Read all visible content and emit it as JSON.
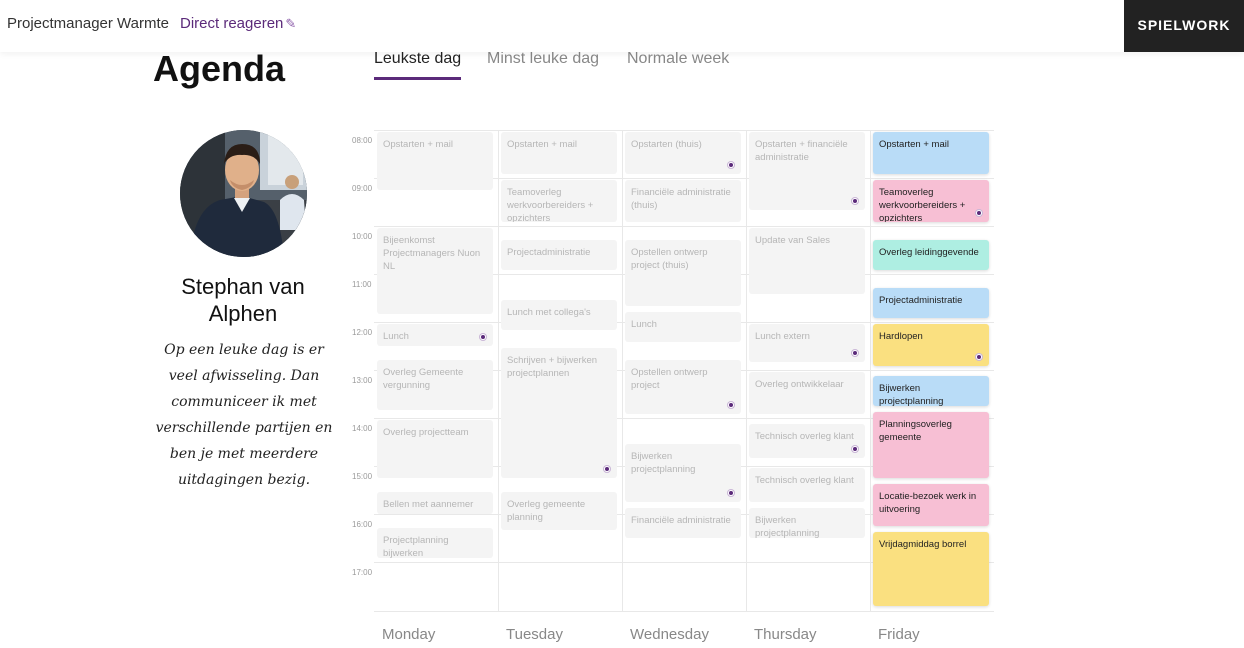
{
  "header": {
    "job_title": "Projectmanager Warmte",
    "apply_label": "Direct reageren",
    "brand": "SPIELWORK",
    "pencil_icon": "pencil-icon"
  },
  "page": {
    "title": "Agenda",
    "tabs": [
      {
        "label": "Leukste dag",
        "active": true
      },
      {
        "label": "Minst leuke dag",
        "active": false
      },
      {
        "label": "Normale week",
        "active": false
      }
    ]
  },
  "profile": {
    "name": "Stephan van Alphen",
    "quote": "Op een leuke dag is er veel afwisseling. Dan communiceer ik met verschillende partijen en ben je met meerdere uitdagingen bezig."
  },
  "calendar": {
    "hours": [
      "08:00",
      "09:00",
      "10:00",
      "11:00",
      "12:00",
      "13:00",
      "14:00",
      "15:00",
      "16:00",
      "17:00"
    ],
    "days": [
      {
        "label": "Monday",
        "events": [
          {
            "title": "Opstarten + mail",
            "start": "08:00",
            "end": "09:15",
            "dot": false
          },
          {
            "title": "Bijeenkomst Projectmanagers Nuon NL",
            "start": "10:00",
            "end": "11:50",
            "dot": false
          },
          {
            "title": "Lunch",
            "start": "12:00",
            "end": "12:30",
            "dot": true
          },
          {
            "title": "Overleg Gemeente vergunning",
            "start": "12:45",
            "end": "13:50",
            "dot": false
          },
          {
            "title": "Overleg projectteam",
            "start": "14:00",
            "end": "15:15",
            "dot": false
          },
          {
            "title": "Bellen met aannemer",
            "start": "15:30",
            "end": "16:00",
            "dot": false
          },
          {
            "title": "Projectplanning bijwerken",
            "start": "16:15",
            "end": "16:55",
            "dot": false
          }
        ]
      },
      {
        "label": "Tuesday",
        "events": [
          {
            "title": "Opstarten + mail",
            "start": "08:00",
            "end": "08:55",
            "dot": false
          },
          {
            "title": "Teamoverleg werkvoorbereiders + opzichters",
            "start": "09:00",
            "end": "09:55",
            "dot": false
          },
          {
            "title": "Projectadministratie",
            "start": "10:15",
            "end": "10:55",
            "dot": false
          },
          {
            "title": "Lunch met collega's",
            "start": "11:30",
            "end": "12:10",
            "dot": false
          },
          {
            "title": "Schrijven + bijwerken projectplannen",
            "start": "12:30",
            "end": "15:15",
            "dot": true
          },
          {
            "title": "Overleg gemeente planning",
            "start": "15:30",
            "end": "16:20",
            "dot": false
          }
        ]
      },
      {
        "label": "Wednesday",
        "events": [
          {
            "title": "Opstarten (thuis)",
            "start": "08:00",
            "end": "08:55",
            "dot": true
          },
          {
            "title": "Financiële administratie (thuis)",
            "start": "09:00",
            "end": "09:55",
            "dot": false
          },
          {
            "title": "Opstellen ontwerp project (thuis)",
            "start": "10:15",
            "end": "11:40",
            "dot": false
          },
          {
            "title": "Lunch",
            "start": "11:45",
            "end": "12:25",
            "dot": false
          },
          {
            "title": "Opstellen ontwerp project",
            "start": "12:45",
            "end": "13:55",
            "dot": true
          },
          {
            "title": "Bijwerken projectplanning",
            "start": "14:30",
            "end": "15:45",
            "dot": true
          },
          {
            "title": "Financiële administratie",
            "start": "15:50",
            "end": "16:30",
            "dot": false
          }
        ]
      },
      {
        "label": "Thursday",
        "events": [
          {
            "title": "Opstarten + financiële administratie",
            "start": "08:00",
            "end": "09:40",
            "dot": true
          },
          {
            "title": "Update van Sales",
            "start": "10:00",
            "end": "11:25",
            "dot": false
          },
          {
            "title": "Lunch extern",
            "start": "12:00",
            "end": "12:50",
            "dot": true
          },
          {
            "title": "Overleg ontwikkelaar",
            "start": "13:00",
            "end": "13:55",
            "dot": false
          },
          {
            "title": "Technisch overleg klant",
            "start": "14:05",
            "end": "14:50",
            "dot": true
          },
          {
            "title": "Technisch overleg klant",
            "start": "15:00",
            "end": "15:45",
            "dot": false
          },
          {
            "title": "Bijwerken projectplanning",
            "start": "15:50",
            "end": "16:30",
            "dot": false
          }
        ]
      },
      {
        "label": "Friday",
        "events": [
          {
            "title": "Opstarten + mail",
            "start": "08:00",
            "end": "08:55",
            "dot": false,
            "color": "#b9dcf7"
          },
          {
            "title": "Teamoverleg werkvoorbereiders + opzichters",
            "start": "09:00",
            "end": "09:55",
            "dot": true,
            "color": "#f7bfd4"
          },
          {
            "title": "Overleg leidinggevende",
            "start": "10:15",
            "end": "10:55",
            "dot": false,
            "color": "#aeeee2"
          },
          {
            "title": "Projectadministratie",
            "start": "11:15",
            "end": "11:55",
            "dot": false,
            "color": "#b9dcf7"
          },
          {
            "title": "Hardlopen",
            "start": "12:00",
            "end": "12:55",
            "dot": true,
            "color": "#fae080"
          },
          {
            "title": "Bijwerken projectplanning",
            "start": "13:05",
            "end": "13:45",
            "dot": false,
            "color": "#b9dcf7"
          },
          {
            "title": "Planningsoverleg gemeente",
            "start": "13:50",
            "end": "15:15",
            "dot": false,
            "color": "#f7bfd4"
          },
          {
            "title": "Locatie-bezoek werk in uitvoering",
            "start": "15:20",
            "end": "16:15",
            "dot": false,
            "color": "#f7bfd4"
          },
          {
            "title": "Vrijdagmiddag borrel",
            "start": "16:20",
            "end": "17:55",
            "dot": false,
            "color": "#fae080"
          }
        ]
      }
    ]
  }
}
